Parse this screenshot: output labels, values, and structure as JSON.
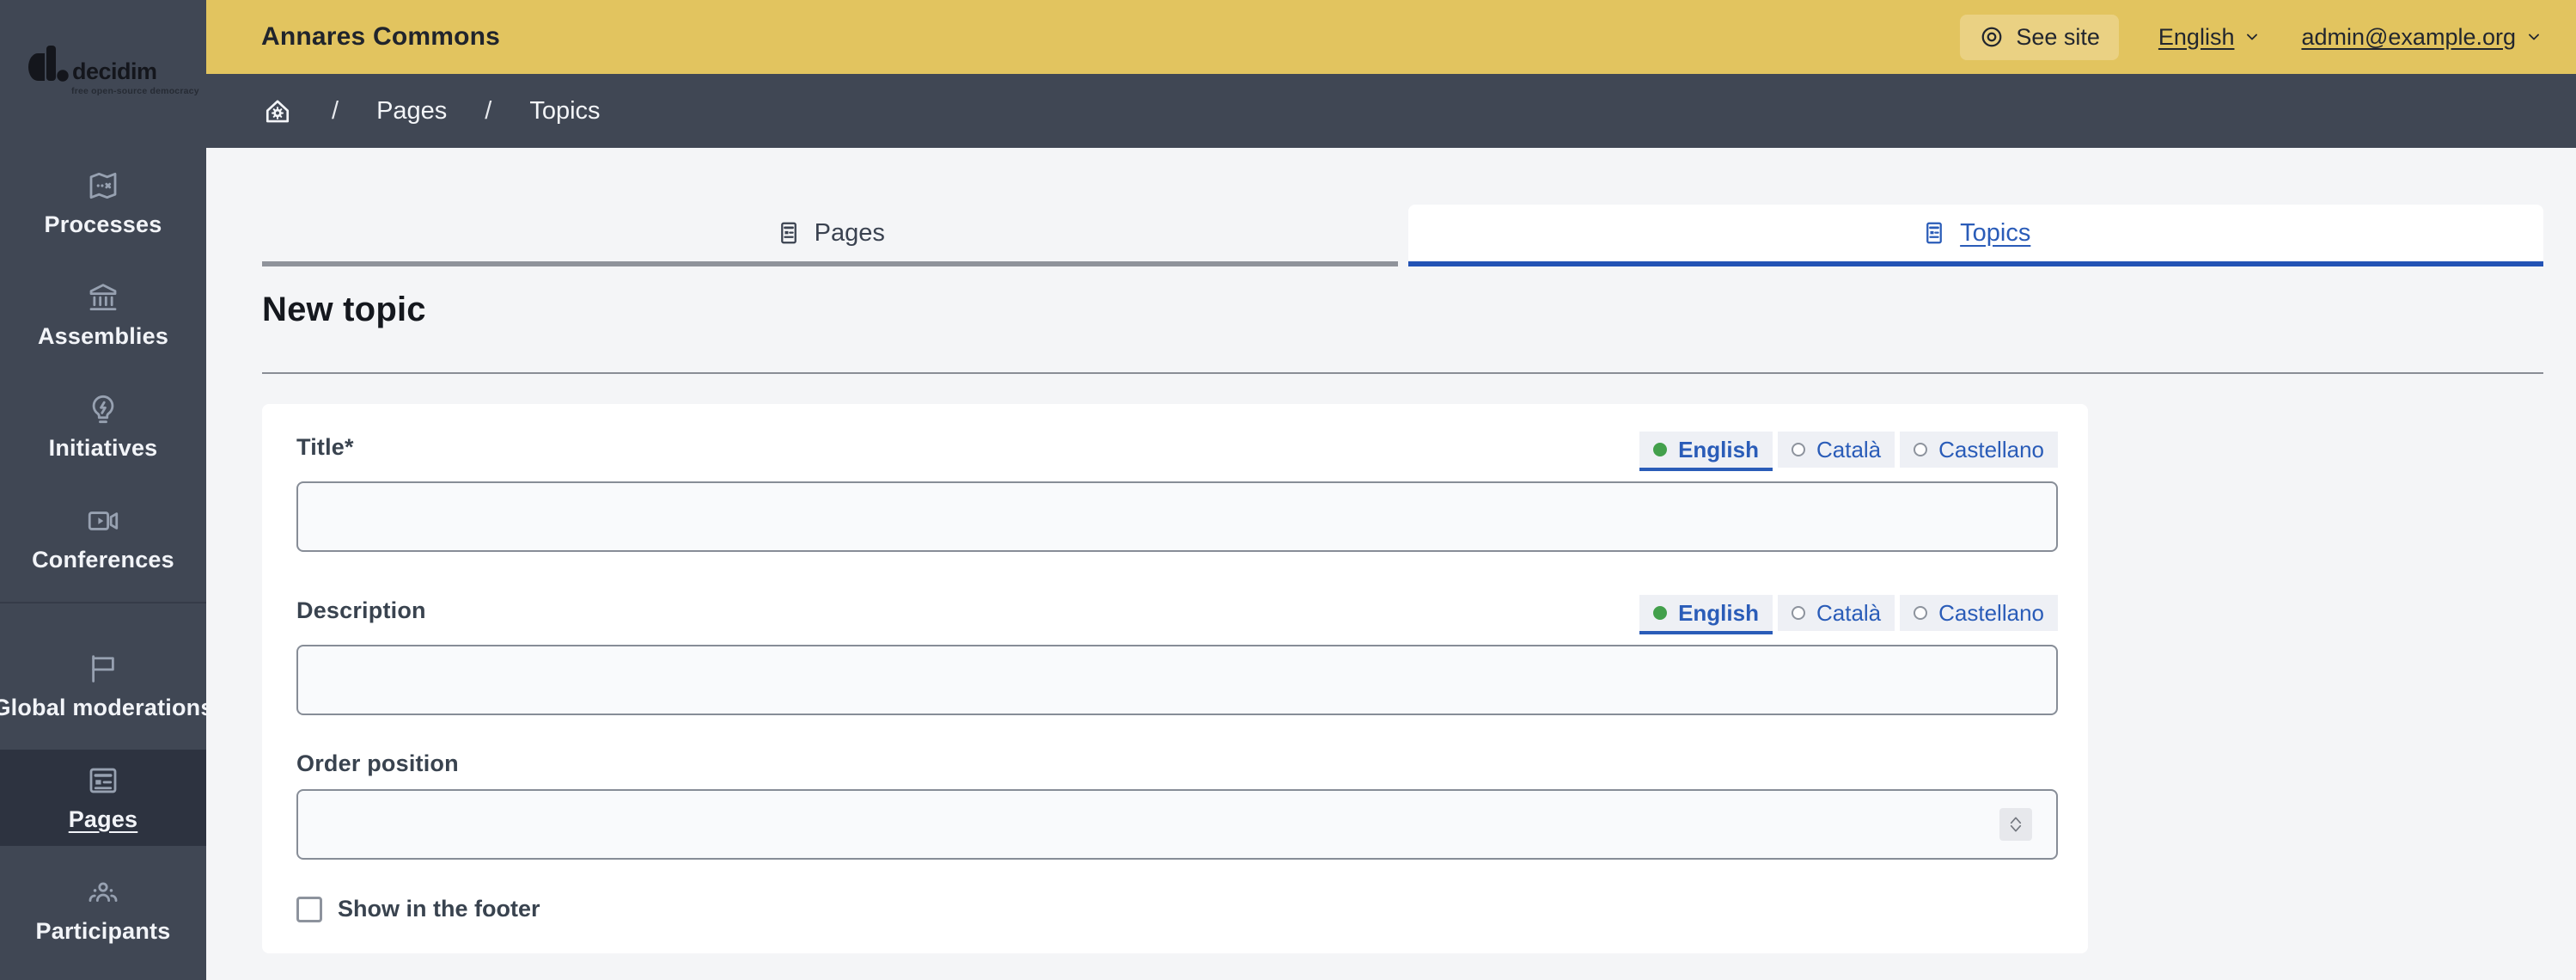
{
  "logo": {
    "brand": "decidim",
    "tagline": "free open-source democracy"
  },
  "topbar": {
    "site_title": "Annares Commons",
    "see_site": "See site",
    "language": "English",
    "account": "admin@example.org"
  },
  "breadcrumb": {
    "separator": "/",
    "items": [
      "Pages",
      "Topics"
    ]
  },
  "sidebar": {
    "items": [
      {
        "label": "Processes",
        "icon": "map-icon",
        "active": false
      },
      {
        "label": "Assemblies",
        "icon": "bank-icon",
        "active": false
      },
      {
        "label": "Initiatives",
        "icon": "lightbulb-flash-icon",
        "active": false
      },
      {
        "label": "Conferences",
        "icon": "video-camera-icon",
        "active": false
      },
      {
        "label": "Global moderations",
        "icon": "flag-icon",
        "active": false
      },
      {
        "label": "Pages",
        "icon": "newspaper-icon",
        "active": true
      },
      {
        "label": "Participants",
        "icon": "group-icon",
        "active": false
      }
    ]
  },
  "tabs": [
    {
      "label": "Pages",
      "icon": "page-icon",
      "active": false
    },
    {
      "label": "Topics",
      "icon": "page-icon",
      "active": true
    }
  ],
  "page": {
    "heading": "New topic"
  },
  "form": {
    "title": {
      "label": "Title*",
      "value": ""
    },
    "description": {
      "label": "Description",
      "value": ""
    },
    "order": {
      "label": "Order position",
      "value": ""
    },
    "languages": [
      {
        "label": "English",
        "selected": true
      },
      {
        "label": "Català",
        "selected": false
      },
      {
        "label": "Castellano",
        "selected": false
      }
    ],
    "checkbox": {
      "label": "Show in the footer",
      "checked": false
    }
  },
  "colors": {
    "topbar_yellow": "#e2c45f",
    "sidebar_dark": "#404754",
    "sidebar_active": "#2d3340",
    "link_blue": "#2a5cb8",
    "tab_bar_blue": "#2353b5",
    "tab_bar_gray": "#8f939b",
    "selected_radio_green": "#43a04c",
    "content_bg": "#f4f5f7"
  }
}
